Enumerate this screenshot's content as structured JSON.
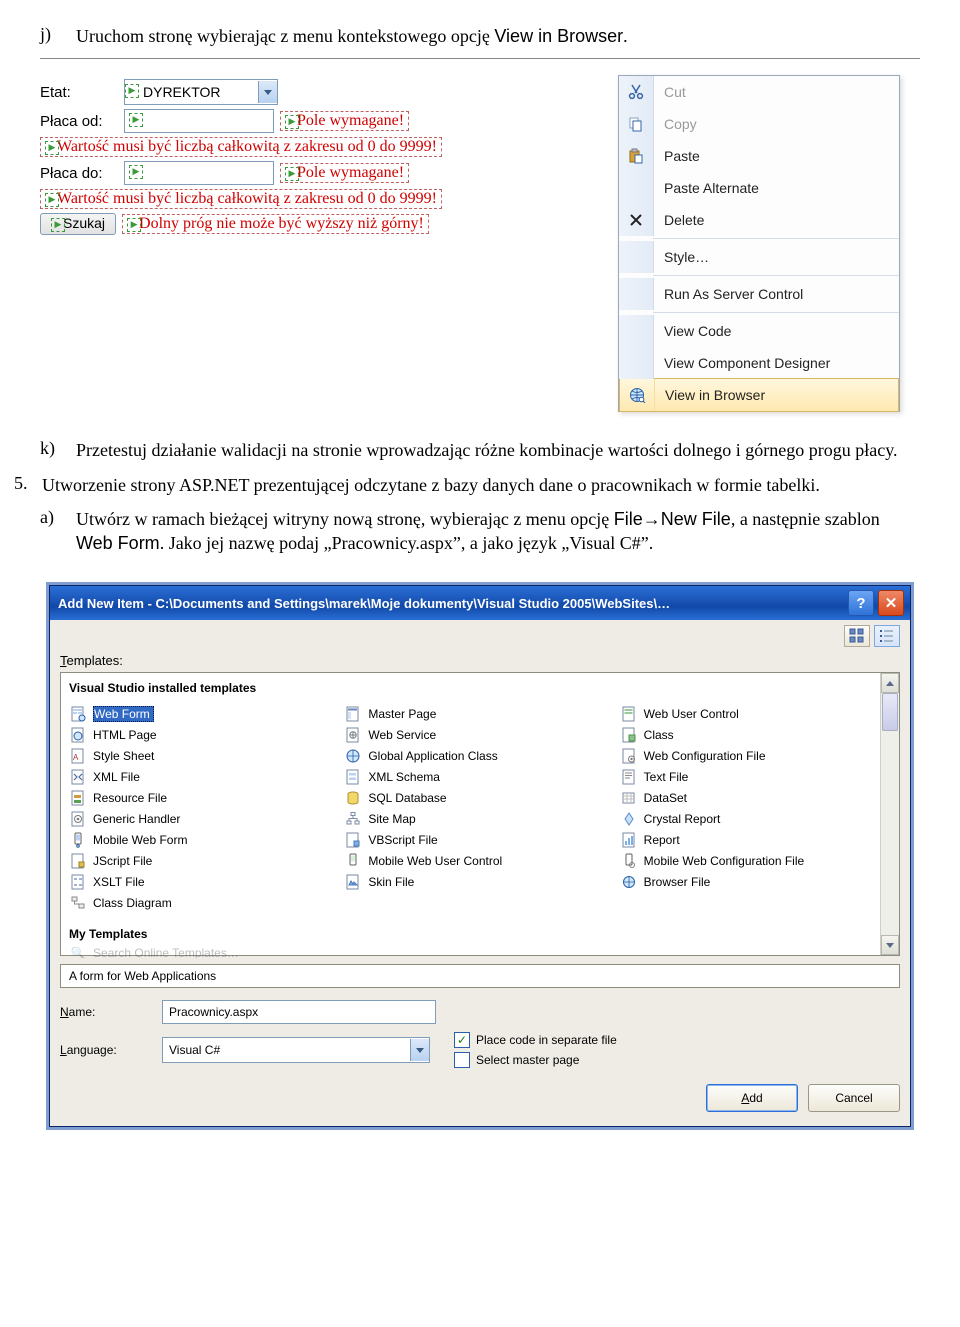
{
  "para_j": {
    "marker": "j)",
    "text_before": "Uruchom stronę wybierając z menu kontekstowego opcję ",
    "option": "View in Browser",
    "text_after": "."
  },
  "form": {
    "etat_label": "Etat:",
    "etat_value": "DYREKTOR",
    "placa_od_label": "Płaca od:",
    "placa_od_err": "Pole wymagane!",
    "range_err": "Wartość musi być liczbą całkowitą z zakresu od 0 do 9999!",
    "placa_do_label": "Płaca do:",
    "placa_do_err": "Pole wymagane!",
    "range_err2": "Wartość musi być liczbą całkowitą z zakresu od 0 do 9999!",
    "szukaj": "Szukaj",
    "prog_err": "Dolny próg nie może być wyższy niż górny!"
  },
  "ctx": {
    "cut": "Cut",
    "copy": "Copy",
    "paste": "Paste",
    "paste_alt": "Paste Alternate",
    "delete": "Delete",
    "style": "Style…",
    "run_server": "Run As Server Control",
    "view_code": "View Code",
    "view_comp": "View Component Designer",
    "view_browser": "View in Browser"
  },
  "para_k": {
    "marker": "k)",
    "text": "Przetestuj działanie walidacji na stronie wprowadzając różne kombinacje wartości dolnego i górnego progu płacy."
  },
  "para5": {
    "marker": "5.",
    "text": "Utworzenie strony ASP.NET prezentującej odczytane z bazy danych dane o pracownikach w formie tabelki."
  },
  "para_a": {
    "marker": "a)",
    "t1": "Utwórz w ramach bieżącej witryny nową stronę, wybierając z menu opcję ",
    "opt1": "File→New File",
    "t2": ", a następnie szablon ",
    "opt2": "Web Form",
    "t3": ". Jako jej nazwę podaj „Pracownicy.aspx”, a jako język „Visual C#”."
  },
  "dialog": {
    "title": "Add New Item - C:\\Documents and Settings\\marek\\Moje dokumenty\\Visual Studio 2005\\WebSites\\…",
    "templates_label": "Templates:",
    "installed_hdr": "Visual Studio installed templates",
    "col1": [
      "Web Form",
      "HTML Page",
      "Style Sheet",
      "XML File",
      "Resource File",
      "Generic Handler",
      "Mobile Web Form",
      "JScript File",
      "XSLT File",
      "Class Diagram"
    ],
    "col2": [
      "Master Page",
      "Web Service",
      "Global Application Class",
      "XML Schema",
      "SQL Database",
      "Site Map",
      "VBScript File",
      "Mobile Web User Control",
      "Skin File"
    ],
    "col3": [
      "Web User Control",
      "Class",
      "Web Configuration File",
      "Text File",
      "DataSet",
      "Crystal Report",
      "Report",
      "Mobile Web Configuration File",
      "Browser File"
    ],
    "my_templates_hdr": "My Templates",
    "cutoff": "Search Online Templates…",
    "desc": "A form for Web Applications",
    "name_label": "Name:",
    "name_value": "Pracownicy.aspx",
    "lang_label": "Language:",
    "lang_value": "Visual C#",
    "chk_sep": "Place code in separate file",
    "chk_master": "Select master page",
    "btn_add": "Add",
    "btn_cancel": "Cancel"
  }
}
